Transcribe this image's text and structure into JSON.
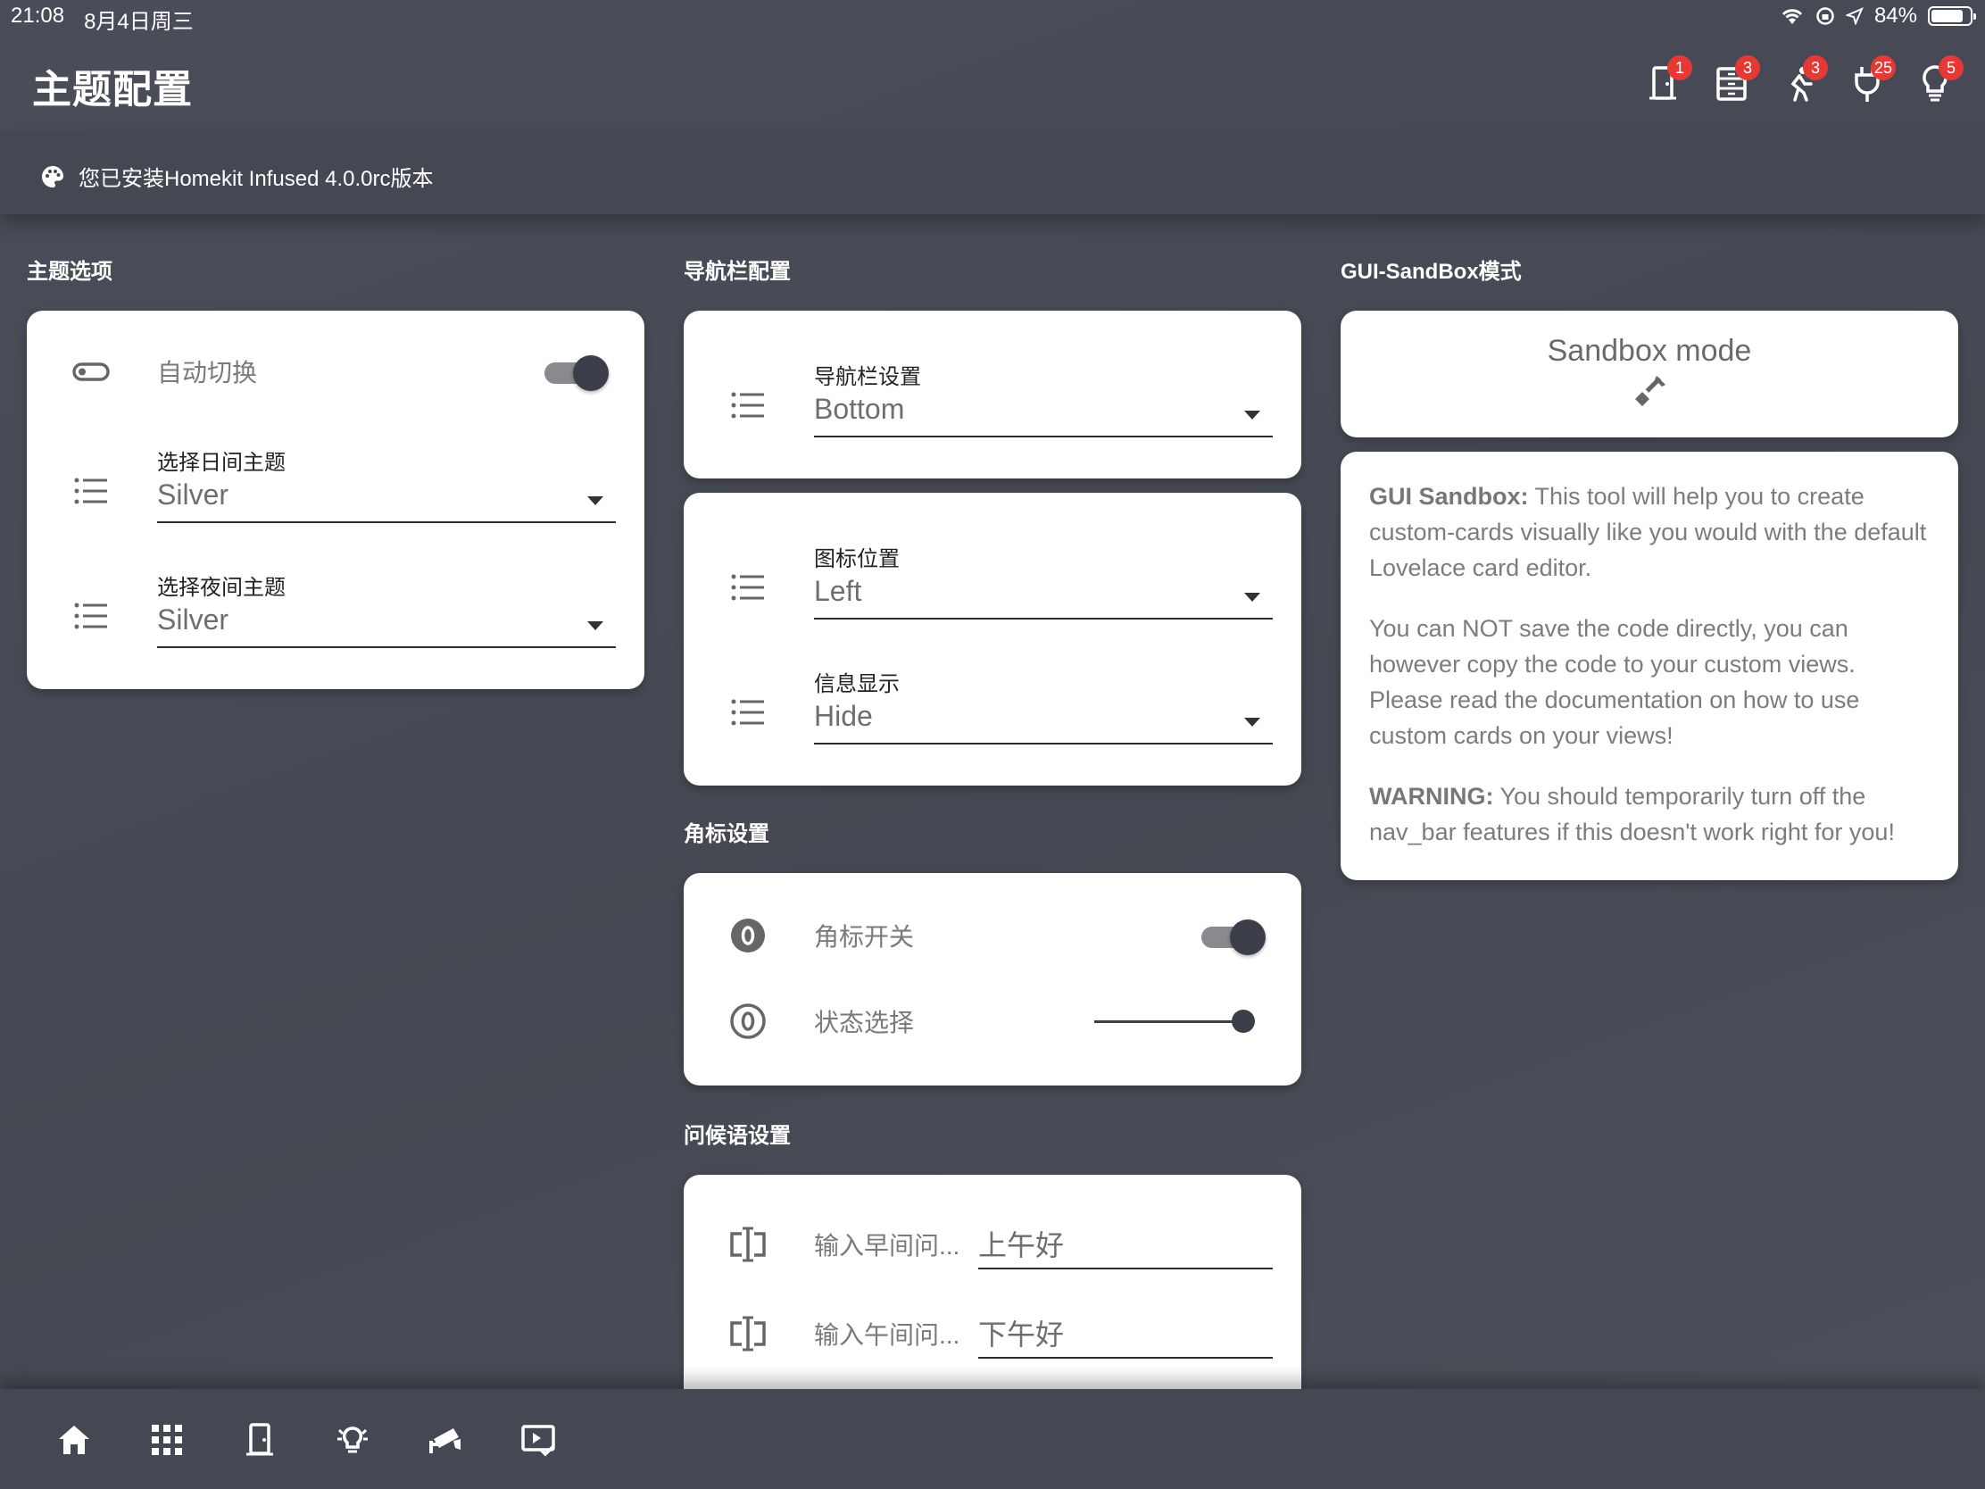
{
  "status_bar": {
    "time": "21:08",
    "date": "8月4日周三",
    "battery": "84%",
    "battery_level": 0.84
  },
  "header": {
    "title": "主题配置",
    "icons": [
      {
        "name": "door-icon",
        "badge": "1"
      },
      {
        "name": "dresser-icon",
        "badge": "3"
      },
      {
        "name": "motion-icon",
        "badge": "3"
      },
      {
        "name": "plug-icon",
        "badge": "25"
      },
      {
        "name": "bulb-icon",
        "badge": "5"
      }
    ]
  },
  "install_note": "您已安装Homekit Infused 4.0.0rc版本",
  "theme_section": {
    "title": "主题选项",
    "auto_switch_label": "自动切换",
    "day_theme": {
      "caption": "选择日间主题",
      "value": "Silver"
    },
    "night_theme": {
      "caption": "选择夜间主题",
      "value": "Silver"
    }
  },
  "navbar_section": {
    "title": "导航栏配置",
    "navbar_setting": {
      "caption": "导航栏设置",
      "value": "Bottom"
    },
    "icon_position": {
      "caption": "图标位置",
      "value": "Left"
    },
    "info_display": {
      "caption": "信息显示",
      "value": "Hide"
    }
  },
  "badge_section": {
    "title": "角标设置",
    "badge_switch_label": "角标开关",
    "state_select_label": "状态选择",
    "state_level": 1.0
  },
  "greeting_section": {
    "title": "问候语设置",
    "morning": {
      "label": "输入早间问...",
      "value": "上午好"
    },
    "afternoon": {
      "label": "输入午间问...",
      "value": "下午好"
    }
  },
  "sandbox_section": {
    "title": "GUI-SandBox模式",
    "button_label": "Sandbox mode",
    "p1_bold": "GUI Sandbox:",
    "p1_text": " This tool will help you to create custom-cards visually like you would with the default Lovelace card editor.",
    "p2_text": "You can NOT save the code directly, you can however copy the code to your custom views. Please read the documentation on how to use custom cards on your views!",
    "p3_bold": "WARNING:",
    "p3_text": " You should temporarily turn off the nav_bar features if this doesn't work right for you!"
  },
  "bottom_nav": [
    "home-icon",
    "apps-grid-icon",
    "door-icon",
    "light-group-icon",
    "camera-icon",
    "playlist-check-icon"
  ],
  "colors": {
    "background": "#484b56",
    "card": "#ffffff",
    "badge": "#e53935",
    "control": "#3b3e48"
  }
}
